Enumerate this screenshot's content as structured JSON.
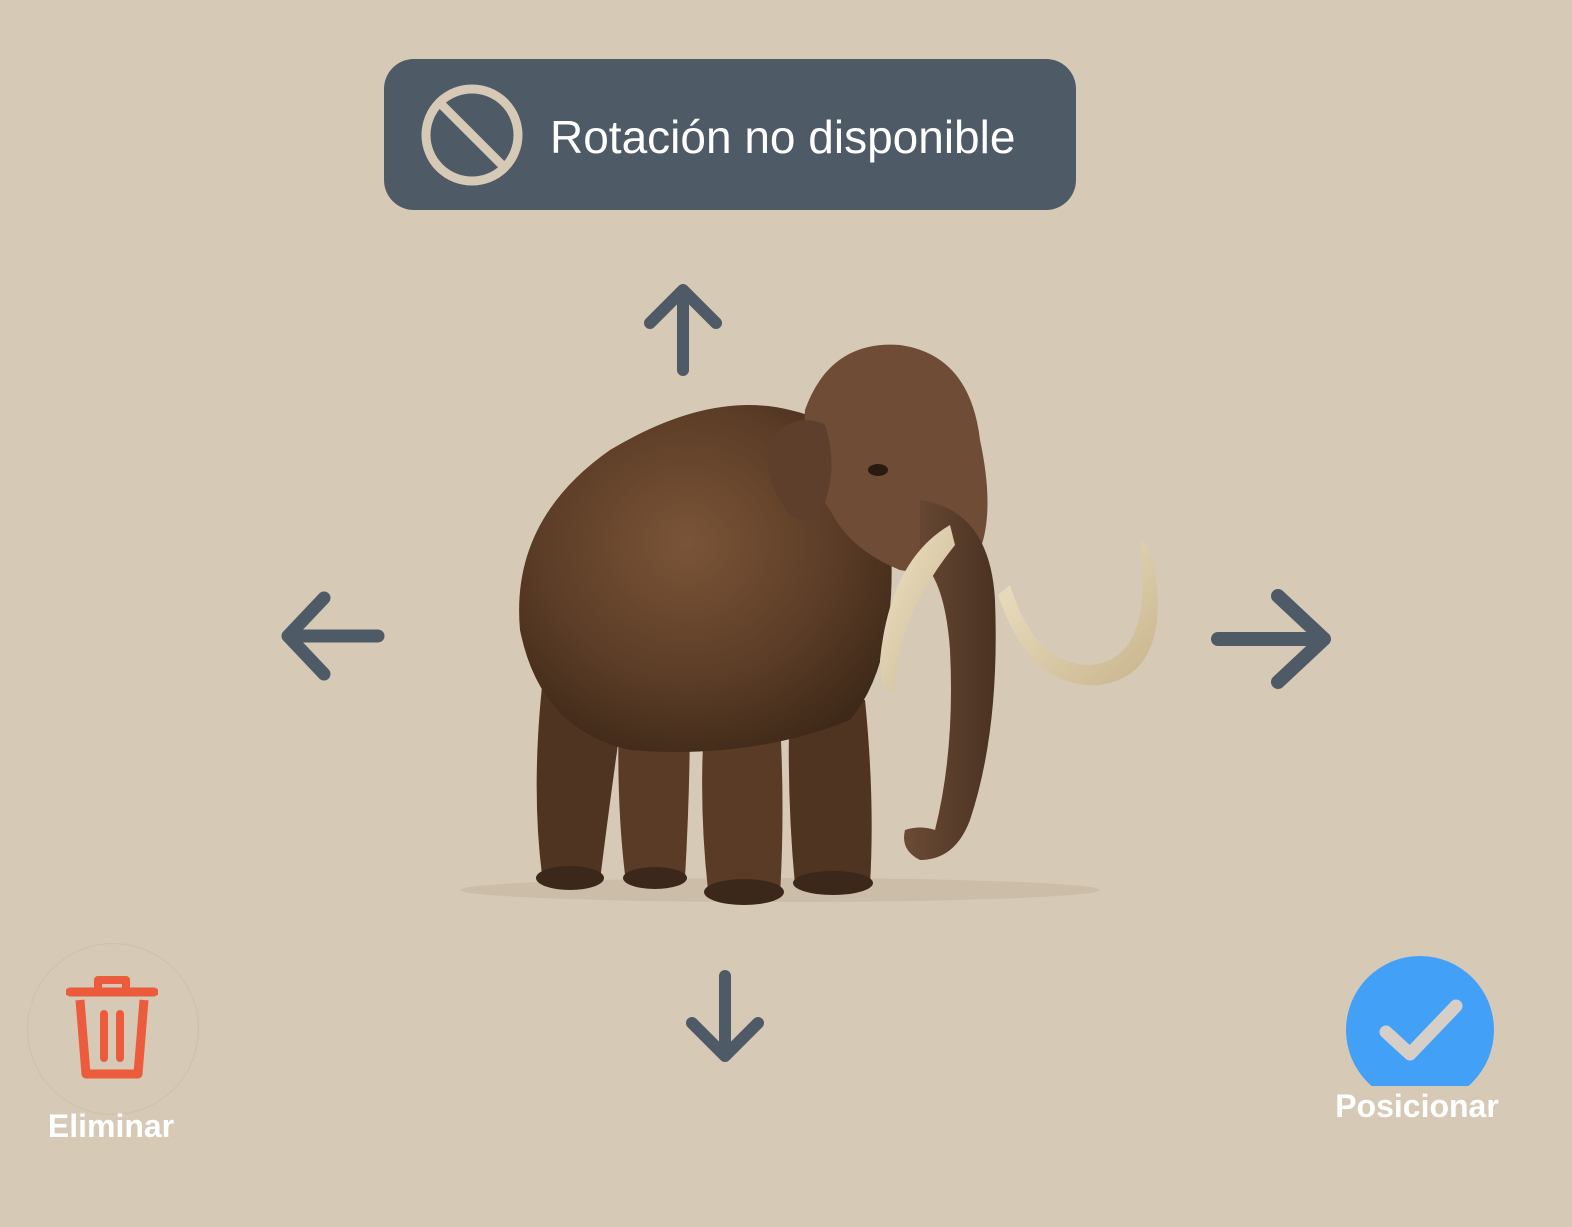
{
  "banner": {
    "icon": "prohibited-icon",
    "text": "Rotación no disponible",
    "background": "#4e5b66"
  },
  "model": {
    "subject": "woolly mammoth"
  },
  "controls": {
    "move_up_icon": "arrow-up-icon",
    "move_down_icon": "arrow-down-icon",
    "move_left_icon": "arrow-left-icon",
    "move_right_icon": "arrow-right-icon",
    "arrow_color": "#4e5b66"
  },
  "actions": {
    "delete": {
      "label": "Eliminar",
      "icon": "trash-icon",
      "color": "#ec5b3b"
    },
    "confirm": {
      "label": "Posicionar",
      "icon": "checkmark-icon",
      "color": "#43a0f7"
    }
  },
  "colors": {
    "background": "#d6c9b6"
  }
}
